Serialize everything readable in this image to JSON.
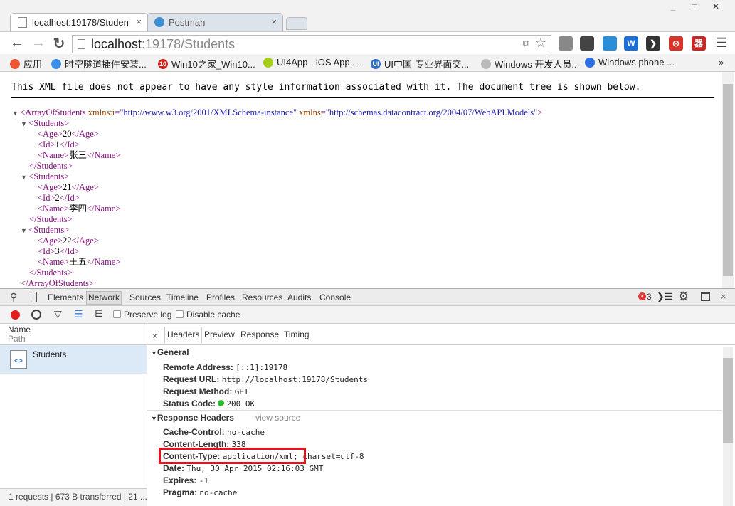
{
  "window": {
    "minimize": "_",
    "maximize": "□",
    "close": "✕"
  },
  "tabs": [
    {
      "title": "localhost:19178/Studen",
      "close": "×",
      "active": true
    },
    {
      "title": "Postman",
      "close": "×",
      "active": false
    }
  ],
  "address": {
    "host": "localhost",
    "path": ":19178/Students"
  },
  "extensions": [
    {
      "icon": "translate-icon",
      "color": "#888"
    },
    {
      "icon": "en-icon",
      "color": "#444"
    },
    {
      "icon": "translate-a-icon",
      "color": "#2a8fd8"
    },
    {
      "icon": "w-icon",
      "color": "#1b6fd8",
      "label": "W"
    },
    {
      "icon": "bracket-icon",
      "color": "#333",
      "label": "❯"
    },
    {
      "icon": "netease-music-icon",
      "color": "#d8322a",
      "label": "⊙"
    },
    {
      "icon": "red-app-icon",
      "color": "#c62828",
      "label": "器"
    }
  ],
  "bookmarks": [
    {
      "label": "应用",
      "icon": "apps-icon",
      "color": "#e53"
    },
    {
      "label": "时空隧道插件安装...",
      "icon": "atom-icon",
      "color": "#3a8ee6"
    },
    {
      "label": "Win10之家_Win10...",
      "icon": "win10-icon",
      "color": "#d0231c",
      "badge": "10"
    },
    {
      "label": "UI4App - iOS App ...",
      "icon": "ui4app-icon",
      "color": "#a6cf1b"
    },
    {
      "label": "UI中国-专业界面交...",
      "icon": "ui-china-icon",
      "color": "#2d6fc4",
      "badge": "UI"
    },
    {
      "label": "Windows 开发人员...",
      "icon": "page-icon",
      "color": "#bbb"
    },
    {
      "label": "Windows phone ...",
      "icon": "windows-phone-icon",
      "color": "#2d6fe0"
    }
  ],
  "bookmarks_more": "»",
  "page": {
    "notice": "This XML file does not appear to have any style information associated with it. The document tree is shown below.",
    "xml": [
      {
        "i": 0,
        "tog": true,
        "s": [
          [
            "tag",
            "<ArrayOfStudents "
          ],
          [
            "attr",
            "xmlns:i"
          ],
          [
            "tag",
            "="
          ],
          [
            "val",
            "\"http://www.w3.org/2001/XMLSchema-instance\""
          ],
          [
            "tag",
            " "
          ],
          [
            "attr",
            "xmlns"
          ],
          [
            "tag",
            "="
          ],
          [
            "val",
            "\"http://schemas.datacontract.org/2004/07/WebAPI.Models\""
          ],
          [
            "tag",
            ">"
          ]
        ]
      },
      {
        "i": 1,
        "tog": true,
        "s": [
          [
            "tag",
            "<Students>"
          ]
        ]
      },
      {
        "i": 2,
        "s": [
          [
            "tag",
            "<Age>"
          ],
          [
            "txt",
            "20"
          ],
          [
            "tag",
            "</Age>"
          ]
        ]
      },
      {
        "i": 2,
        "s": [
          [
            "tag",
            "<Id>"
          ],
          [
            "txt",
            "1"
          ],
          [
            "tag",
            "</Id>"
          ]
        ]
      },
      {
        "i": 2,
        "s": [
          [
            "tag",
            "<Name>"
          ],
          [
            "txt",
            "张三"
          ],
          [
            "tag",
            "</Name>"
          ]
        ]
      },
      {
        "i": 1,
        "s": [
          [
            "tag",
            "</Students>"
          ]
        ]
      },
      {
        "i": 1,
        "tog": true,
        "s": [
          [
            "tag",
            "<Students>"
          ]
        ]
      },
      {
        "i": 2,
        "s": [
          [
            "tag",
            "<Age>"
          ],
          [
            "txt",
            "21"
          ],
          [
            "tag",
            "</Age>"
          ]
        ]
      },
      {
        "i": 2,
        "s": [
          [
            "tag",
            "<Id>"
          ],
          [
            "txt",
            "2"
          ],
          [
            "tag",
            "</Id>"
          ]
        ]
      },
      {
        "i": 2,
        "s": [
          [
            "tag",
            "<Name>"
          ],
          [
            "txt",
            "李四"
          ],
          [
            "tag",
            "</Name>"
          ]
        ]
      },
      {
        "i": 1,
        "s": [
          [
            "tag",
            "</Students>"
          ]
        ]
      },
      {
        "i": 1,
        "tog": true,
        "s": [
          [
            "tag",
            "<Students>"
          ]
        ]
      },
      {
        "i": 2,
        "s": [
          [
            "tag",
            "<Age>"
          ],
          [
            "txt",
            "22"
          ],
          [
            "tag",
            "</Age>"
          ]
        ]
      },
      {
        "i": 2,
        "s": [
          [
            "tag",
            "<Id>"
          ],
          [
            "txt",
            "3"
          ],
          [
            "tag",
            "</Id>"
          ]
        ]
      },
      {
        "i": 2,
        "s": [
          [
            "tag",
            "<Name>"
          ],
          [
            "txt",
            "王五"
          ],
          [
            "tag",
            "</Name>"
          ]
        ]
      },
      {
        "i": 1,
        "s": [
          [
            "tag",
            "</Students>"
          ]
        ]
      },
      {
        "i": 0,
        "s": [
          [
            "tag",
            "</ArrayOfStudents>"
          ]
        ]
      }
    ]
  },
  "devtools": {
    "tabs": [
      "Elements",
      "Network",
      "Sources",
      "Timeline",
      "Profiles",
      "Resources",
      "Audits",
      "Console"
    ],
    "active_tab": "Network",
    "error_count": "3",
    "preserve_log": "Preserve log",
    "disable_cache": "Disable cache",
    "col_name": "Name",
    "col_path": "Path",
    "request_name": "Students",
    "status_bar": "1 requests | 673 B transferred | 21 ...",
    "detail_tabs": [
      "Headers",
      "Preview",
      "Response",
      "Timing"
    ],
    "close": "×",
    "general": {
      "title": "General",
      "rows": [
        [
          "Remote Address:",
          "[::1]:19178"
        ],
        [
          "Request URL:",
          "http://localhost:19178/Students"
        ],
        [
          "Request Method:",
          "GET"
        ],
        [
          "Status Code:",
          "200 OK"
        ]
      ]
    },
    "response_headers": {
      "title": "Response Headers",
      "view_source": "view source",
      "rows": [
        [
          "Cache-Control:",
          "no-cache"
        ],
        [
          "Content-Length:",
          "338"
        ],
        [
          "Content-Type:",
          "application/xml; charset=utf-8"
        ],
        [
          "Date:",
          "Thu, 30 Apr 2015 02:16:03 GMT"
        ],
        [
          "Expires:",
          "-1"
        ],
        [
          "Pragma:",
          "no-cache"
        ]
      ]
    },
    "highlight_color": "#e0141e"
  }
}
